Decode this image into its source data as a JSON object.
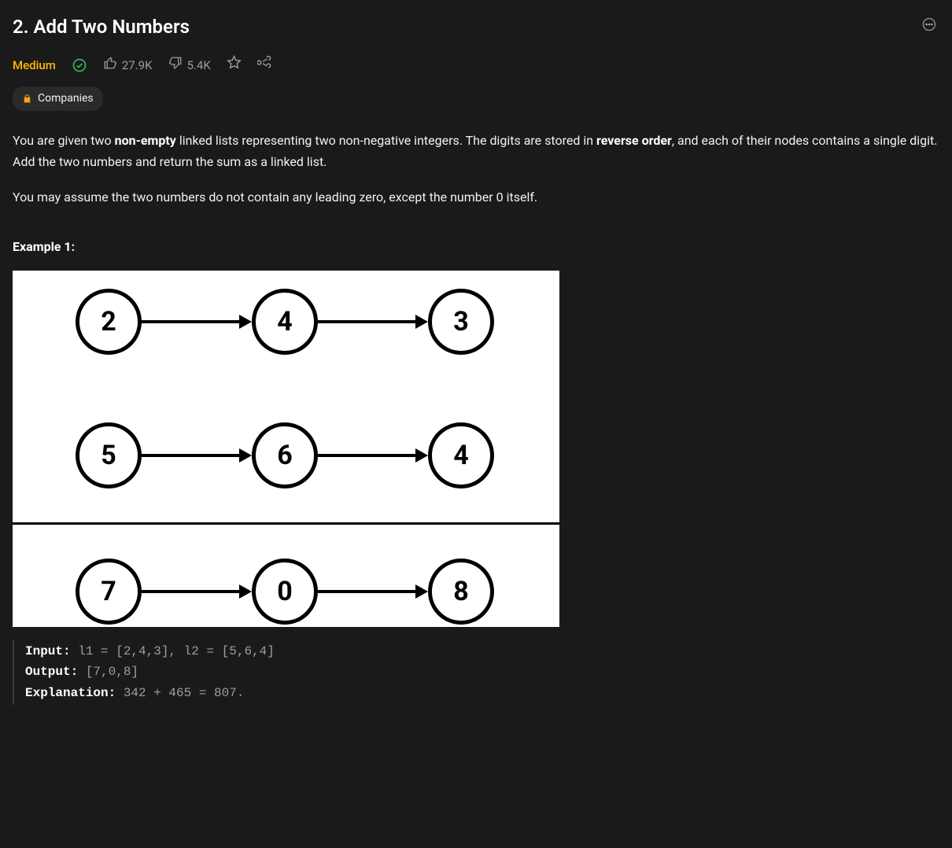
{
  "header": {
    "title": "2. Add Two Numbers"
  },
  "meta": {
    "difficulty": "Medium",
    "likes": "27.9K",
    "dislikes": "5.4K"
  },
  "tags": {
    "companies": "Companies"
  },
  "description": {
    "p1_a": "You are given two ",
    "p1_b": "non-empty",
    "p1_c": " linked lists representing two non-negative integers. The digits are stored in ",
    "p1_d": "reverse order",
    "p1_e": ", and each of their nodes contains a single digit. Add the two numbers and return the sum as a linked list.",
    "p2": "You may assume the two numbers do not contain any leading zero, except the number 0 itself."
  },
  "example": {
    "heading": "Example 1:",
    "diagram": {
      "list1": [
        "2",
        "4",
        "3"
      ],
      "list2": [
        "5",
        "6",
        "4"
      ],
      "result": [
        "7",
        "0",
        "8"
      ]
    },
    "code": {
      "input_label": "Input:",
      "input_value": " l1 = [2,4,3], l2 = [5,6,4]",
      "output_label": "Output:",
      "output_value": " [7,0,8]",
      "explanation_label": "Explanation:",
      "explanation_value": " 342 + 465 = 807."
    }
  }
}
